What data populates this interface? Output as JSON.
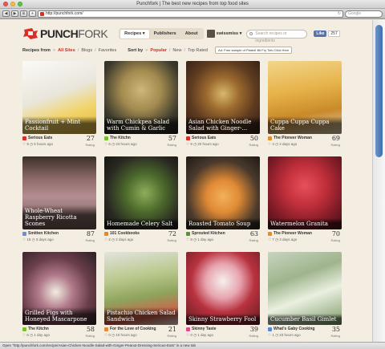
{
  "browser": {
    "title": "Punchfork | The best new recipes from top food sites",
    "url": "http://punchfork.com/",
    "search_placeholder": "Google",
    "status_text": "Open \"http://punchfork.com/recipe/Asian-Chicken-Noodle-Salad-with-Ginger-Peanut-Dressing-Serious-Eats\" in a new tab"
  },
  "header": {
    "logo_bold": "PUNCH",
    "logo_light": "FORK",
    "nav": [
      "Recipes ▾",
      "Publishers",
      "About"
    ],
    "user_name": "swissmiss ▾",
    "search_placeholder": "Search recipes or ingredients",
    "like_label": "Like",
    "like_count": "257"
  },
  "filters": {
    "recipes_from": "Recipes from",
    "all_sites": "All Sites",
    "blogs": "Blogs",
    "favorites": "Favorites",
    "sort_by": "Sort by",
    "popular": "Popular",
    "new": "New",
    "top_rated": "Top Rated",
    "promo": "Ad: Free sample of Plated! Bit Fry Tofu Click Here"
  },
  "colors": {
    "accent_red": "#c8332a",
    "background": "#f4ede1"
  },
  "recipes": [
    {
      "title": "Passionfruit + Mint Cocktail",
      "source": "Serious Eats",
      "likes": "9",
      "time": "5 hours ago",
      "score": "27",
      "rating_label": "Rating",
      "icon": "#d6302a",
      "bg": "linear-gradient(160deg,#fbfaf6 0%,#e9e6dc 45%,#f1d46a 70%,#e3b63a 100%)"
    },
    {
      "title": "Warm Chickpea Salad with Cumin & Garlic",
      "source": "The Kitchn",
      "likes": "6",
      "time": "23 hours ago",
      "score": "57",
      "rating_label": "Rating",
      "icon": "#7bbd2f",
      "bg": "radial-gradient(circle at 50% 40%,#cdb67a 0%,#a38a4f 35%,#3b3a2c 70%,#1c1c18 100%)"
    },
    {
      "title": "Asian Chicken Noodle Salad with Ginger-...",
      "source": "Serious Eats",
      "likes": "9",
      "time": "20 hours ago",
      "score": "50",
      "rating_label": "Rating",
      "icon": "#d6302a",
      "bg": "radial-gradient(circle at 50% 45%,#d8b86c 0%,#9c6a2e 30%,#5e3b20 60%,#2b1c14 100%)"
    },
    {
      "title": "Cuppa Cuppa Cuppa Cake",
      "source": "The Pioneer Woman",
      "likes": "4",
      "time": "2 days ago",
      "score": "69",
      "rating_label": "Rating",
      "icon": "#e08f2d",
      "bg": "linear-gradient(170deg,#f2d78a 0%,#e7b24a 40%,#c98a2a 70%,#e6d6b8 100%)"
    },
    {
      "title": "Whole-Wheat Raspberry Ricotta Scones",
      "source": "Smitten Kitchen",
      "likes": "16",
      "time": "3 days ago",
      "score": "87",
      "rating_label": "Rating",
      "icon": "#6d8fd0",
      "bg": "linear-gradient(180deg,#3a3028 0%,#8d6a6a 30%,#b48d91 55%,#6b5650 100%)"
    },
    {
      "title": "Homemade Celery Salt",
      "source": "101 Cookbooks",
      "likes": "2",
      "time": "2 days ago",
      "score": "72",
      "rating_label": "Rating",
      "icon": "#e0892f",
      "bg": "radial-gradient(circle at 55% 50%,#8fae5a 0%,#4d6b2c 35%,#2a2a22 70%,#151512 100%)"
    },
    {
      "title": "Roasted Tomato Soup",
      "source": "Sprouted Kitchen",
      "likes": "8",
      "time": "1 day ago",
      "score": "63",
      "rating_label": "Rating",
      "icon": "#5d8f3a",
      "bg": "radial-gradient(circle at 50% 55%,#f3b05a 0%,#e08a35 30%,#4a3a2c 65%,#1f1a16 100%)"
    },
    {
      "title": "Watermelon Granita",
      "source": "The Pioneer Woman",
      "likes": "7",
      "time": "3 days ago",
      "score": "70",
      "rating_label": "Rating",
      "icon": "#e08f2d",
      "bg": "radial-gradient(circle at 50% 40%,#e6505a 0%,#c2303c 35%,#7a1a25 70%,#3b1216 100%)"
    },
    {
      "title": "Grilled Figs with Honeyed Mascarpone",
      "source": "The Kitchn",
      "likes": "6",
      "time": "1 day ago",
      "score": "58",
      "rating_label": "Rating",
      "icon": "#7bbd2f",
      "bg": "radial-gradient(circle at 45% 55%,#f2ece0 0%,#b07a8a 30%,#6a3e4a 60%,#2b2024 100%)"
    },
    {
      "title": "Pistachio Chicken Salad Sandwich",
      "source": "For the Love of Cooking",
      "likes": "0",
      "time": "10 hours ago",
      "score": "21",
      "rating_label": "Rating",
      "icon": "#e0892f",
      "bg": "linear-gradient(170deg,#e3e3dd 0%,#b9c98d 35%,#8ea35c 60%,#d35c4a 85%,#f0ede4 100%)"
    },
    {
      "title": "Skinny Strawberry Fool",
      "source": "Skinny Taste",
      "likes": "0",
      "time": "1 day ago",
      "score": "39",
      "rating_label": "Rating",
      "icon": "#e04a8a",
      "bg": "radial-gradient(circle at 50% 40%,#f5f0ec 0%,#e7a5b0 30%,#b8323f 55%,#5e1b20 100%)"
    },
    {
      "title": "Cucumber Basil Gimlet",
      "source": "What's Gaby Cooking",
      "likes": "1",
      "time": "23 hours ago",
      "score": "35",
      "rating_label": "Rating",
      "icon": "#5a8ad0",
      "bg": "linear-gradient(160deg,#c9d4bf 0%,#9fb48d 35%,#eaf0e0 60%,#7d9a6a 100%)"
    }
  ]
}
